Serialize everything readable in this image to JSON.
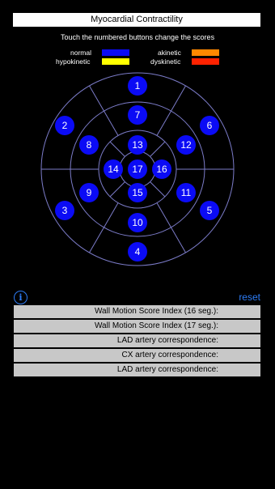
{
  "header": {
    "title": "Myocardial Contractility"
  },
  "instructions": "Touch the numbered buttons change the scores",
  "legend": [
    {
      "label": "normal",
      "color": "#0b0bf5"
    },
    {
      "label": "hypokinetic",
      "color": "#ffff00"
    },
    {
      "label": "akinetic",
      "color": "#ff8800"
    },
    {
      "label": "dyskinetic",
      "color": "#ff2200"
    }
  ],
  "segments": [
    "1",
    "2",
    "3",
    "4",
    "5",
    "6",
    "7",
    "8",
    "9",
    "10",
    "11",
    "12",
    "13",
    "14",
    "15",
    "16",
    "17"
  ],
  "controls": {
    "info_label": "i",
    "reset_label": "reset"
  },
  "results": [
    "Wall Motion Score Index (16 seg.):",
    "Wall Motion Score Index (17 seg.):",
    "LAD artery correspondence:",
    "CX artery correspondence:",
    "LAD artery correspondence:"
  ]
}
